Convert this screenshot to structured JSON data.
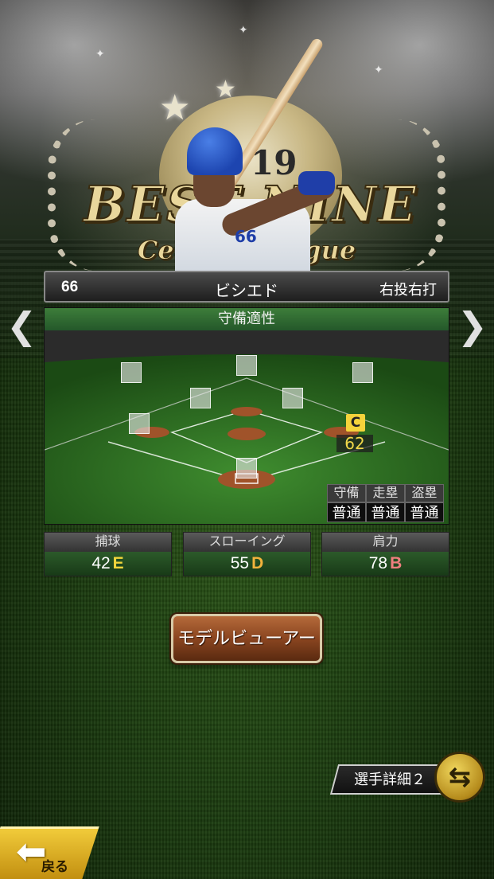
{
  "emblem": {
    "year": "19",
    "title": "BEST NINE",
    "league": "Central League"
  },
  "player": {
    "number": "66",
    "name": "ビシエド",
    "throw_bat": "右投右打",
    "jersey_number": "66"
  },
  "defense_panel": {
    "title": "守備適性",
    "current_position_rank": "C",
    "current_position_rating": "62",
    "stats_headers": [
      "守備",
      "走塁",
      "盗塁"
    ],
    "stats_values": [
      "普通",
      "普通",
      "普通"
    ]
  },
  "ratings": [
    {
      "label": "捕球",
      "value": "42",
      "grade": "E",
      "grade_color": "#f2d53c"
    },
    {
      "label": "スローイング",
      "value": "55",
      "grade": "D",
      "grade_color": "#f2b33c"
    },
    {
      "label": "肩力",
      "value": "78",
      "grade": "B",
      "grade_color": "#f07f7f"
    }
  ],
  "buttons": {
    "model_viewer": "モデルビューアー",
    "player_detail": "選手詳細２",
    "back": "戻る"
  },
  "icons": {
    "prev": "chevron-left-icon",
    "next": "chevron-right-icon",
    "swap": "swap-icon",
    "back": "back-arrow-icon"
  },
  "colors": {
    "accent_gold": "#f5d33b",
    "panel_green": "#2c5a2a"
  }
}
